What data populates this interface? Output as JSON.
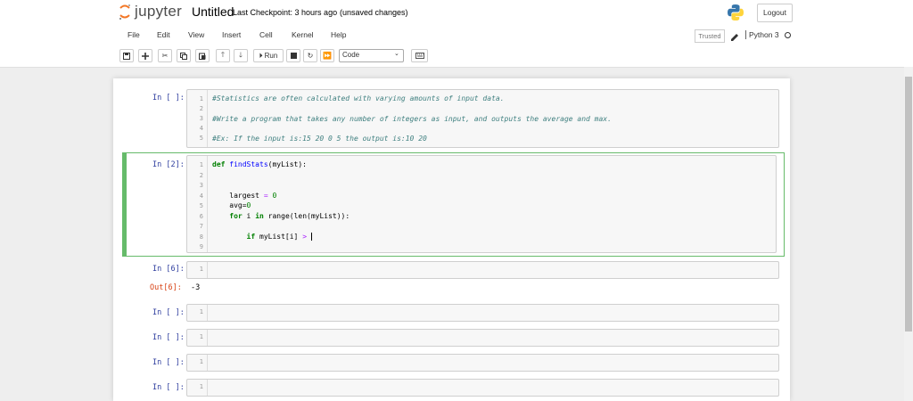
{
  "header": {
    "logo_text": "jupyter",
    "notebook_title": "Untitled",
    "checkpoint": "Last Checkpoint: 3 hours ago",
    "save_status": "(unsaved changes)",
    "logout_label": "Logout"
  },
  "menu": {
    "items": [
      "File",
      "Edit",
      "View",
      "Insert",
      "Cell",
      "Kernel",
      "Help"
    ],
    "trusted_label": "Trusted",
    "kernel_name": "Python 3"
  },
  "toolbar": {
    "run_label": "Run",
    "cell_type": "Code"
  },
  "cells": {
    "c1": {
      "prompt": "In [ ]:",
      "lines": [
        "#Statistics are often calculated with varying amounts of input data.",
        "",
        "#Write a program that takes any number of integers as input, and outputs the average and max.",
        "",
        "#Ex: If the input is:15 20 0 5 the output is:10 20"
      ]
    },
    "c2": {
      "prompt": "In [2]:",
      "line_numbers": [
        "1",
        "2",
        "3",
        "4",
        "5",
        "6",
        "7",
        "8",
        "9"
      ]
    },
    "c3": {
      "prompt": "In [6]:",
      "out_prompt": "Out[6]:",
      "output": "-3"
    },
    "c4": {
      "prompt": "In [ ]:"
    },
    "c5": {
      "prompt": "In [ ]:"
    },
    "c6": {
      "prompt": "In [ ]:"
    },
    "c7": {
      "prompt": "In [ ]:"
    }
  },
  "code_c2": {
    "def_kw": "def",
    "fn_name": "findStats",
    "params": "(myList):",
    "largest_var": "largest",
    "eq": "=",
    "zero": "0",
    "avg": "avg=",
    "avg_zero": "0",
    "for_kw": "for",
    "i_var": "i",
    "in_kw": "in",
    "range_call": "range(len(myList)):",
    "if_kw": "if",
    "if_expr": "myList[i]",
    "gt": ">"
  },
  "colors": {
    "selected_border": "#66bb6a",
    "prompt_in": "#303f9f",
    "prompt_out": "#d84315",
    "comment": "#408080",
    "keyword": "#008000"
  }
}
